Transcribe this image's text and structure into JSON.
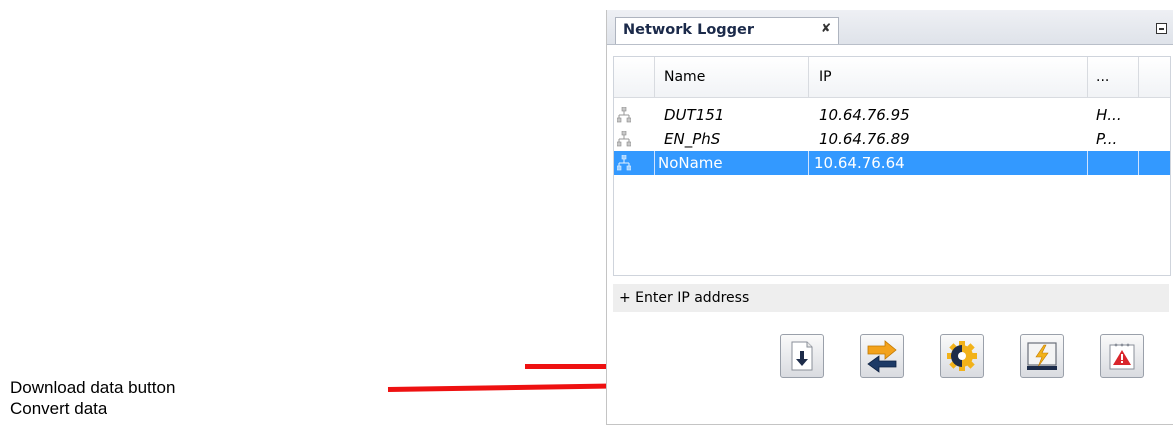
{
  "annotations": {
    "download_label": "Download data button",
    "convert_label": "Convert data"
  },
  "panel": {
    "tab_title": "Network Logger",
    "close_glyph": "✘",
    "columns": [
      "Name",
      "IP",
      "..."
    ],
    "rows": [
      {
        "name": "DUT151",
        "ip": "10.64.76.95",
        "extra": "H...",
        "selected": false
      },
      {
        "name": "EN_PhS",
        "ip": "10.64.76.89",
        "extra": "P...",
        "selected": false
      },
      {
        "name": "NoName",
        "ip": "10.64.76.64",
        "extra": "",
        "selected": true
      }
    ],
    "add_ip_label": "+ Enter IP address",
    "toolbar": [
      {
        "icon": "download-icon"
      },
      {
        "icon": "convert-icon"
      },
      {
        "icon": "settings-icon"
      },
      {
        "icon": "power-icon"
      },
      {
        "icon": "alarm-calendar-icon"
      }
    ]
  },
  "colors": {
    "arrow": "#ee1111",
    "selection": "#3399ff"
  }
}
